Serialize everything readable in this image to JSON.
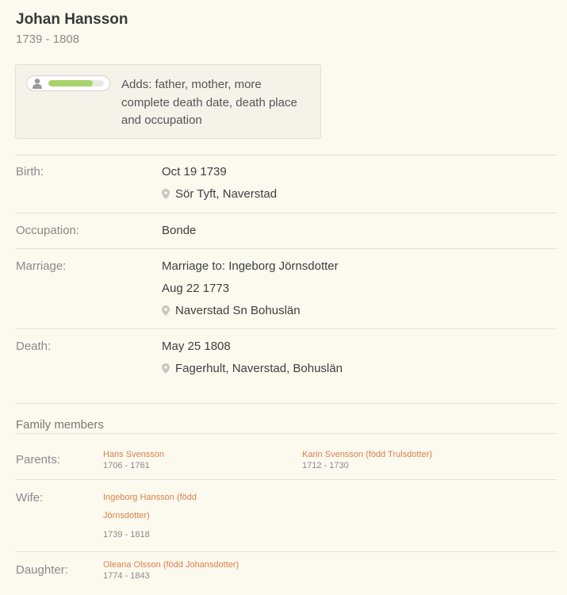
{
  "person": {
    "name": "Johan Hansson",
    "years": "1739 - 1808"
  },
  "adds": {
    "progress": 0.8,
    "text": "Adds: father, mother, more complete death date, death place and occupation"
  },
  "facts": {
    "birth": {
      "label": "Birth:",
      "date": "Oct 19 1739",
      "place": "Sör Tyft, Naverstad"
    },
    "occupation": {
      "label": "Occupation:",
      "value": "Bonde"
    },
    "marriage": {
      "label": "Marriage:",
      "spouse": "Marriage to: Ingeborg Jörnsdotter",
      "date": "Aug 22 1773",
      "place": "Naverstad Sn Bohuslän"
    },
    "death": {
      "label": "Death:",
      "date": "May 25 1808",
      "place": "Fagerhult, Naverstad, Bohuslän"
    }
  },
  "family": {
    "title": "Family members",
    "parents": {
      "label": "Parents:",
      "father": {
        "name": "Hans Svensson",
        "years": "1706 - 1761"
      },
      "mother": {
        "name": "Karin Svensson (född Trulsdotter)",
        "years": "1712 - 1730"
      }
    },
    "wife": {
      "label": "Wife:",
      "name_line1": "Ingeborg Hansson (född",
      "name_line2": "Jörnsdotter)",
      "years": "1739 - 1818"
    },
    "daughter": {
      "label": "Daughter:",
      "name": "Oleana Olsson (född Johansdotter)",
      "years": "1774 - 1843"
    }
  },
  "colors": {
    "link": "#d8824a",
    "progress_fill": "#a8d46a",
    "background": "#fcf9ef"
  }
}
